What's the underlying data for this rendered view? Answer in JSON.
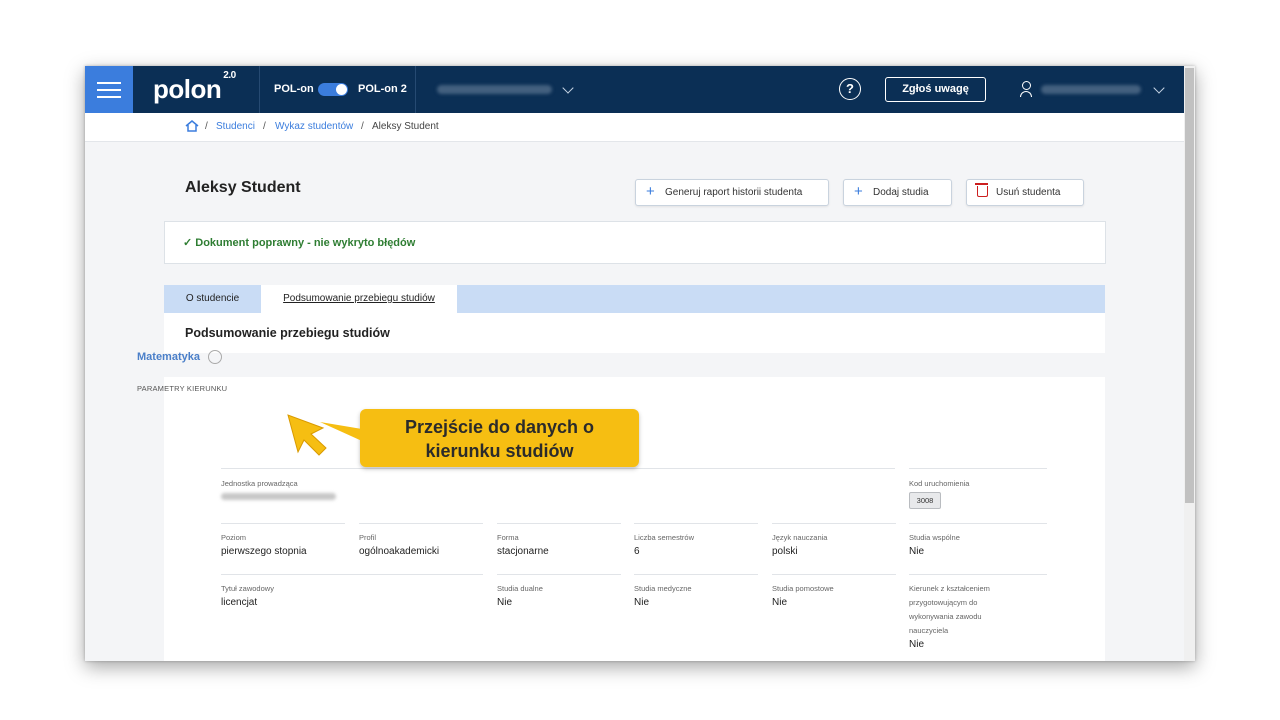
{
  "topbar": {
    "logo_text": "polon",
    "logo_sup": "2.0",
    "toggle_left": "POL-on",
    "toggle_right": "POL-on 2",
    "toggle_on": true,
    "help_icon": "help-circle-icon",
    "report_button": "Zgłoś uwagę",
    "user_icon": "user-icon",
    "accent_color": "#3b7ddd",
    "bar_color": "#0b2f55"
  },
  "breadcrumb": {
    "home_icon": "home-icon",
    "items": [
      "Studenci",
      "Wykaz studentów",
      "Aleksy Student"
    ],
    "separator": "/"
  },
  "page": {
    "title": "Aleksy Student",
    "buttons": {
      "report": "Generuj raport historii studenta",
      "add_studies": "Dodaj studia",
      "delete": "Usuń studenta"
    },
    "status_message": "✓ Dokument poprawny - nie wykryto błędów",
    "tabs": [
      "O studencie",
      "Podsumowanie przebiegu studiów"
    ],
    "active_tab": 1,
    "section_title": "Podsumowanie przebiegu studiów"
  },
  "program": {
    "link_label": "Matematyka",
    "params_header": "PARAMETRY KIERUNKU",
    "fields": {
      "unit": {
        "label": "Jednostka prowadząca",
        "value": ""
      },
      "launch_code": {
        "label": "Kod uruchomienia",
        "value": "3008"
      },
      "level": {
        "label": "Poziom",
        "value": "pierwszego stopnia"
      },
      "profile": {
        "label": "Profil",
        "value": "ogólnoakademicki"
      },
      "form": {
        "label": "Forma",
        "value": "stacjonarne"
      },
      "semesters": {
        "label": "Liczba semestrów",
        "value": "6"
      },
      "language": {
        "label": "Język nauczania",
        "value": "polski"
      },
      "joint": {
        "label": "Studia wspólne",
        "value": "Nie"
      },
      "title": {
        "label": "Tytuł zawodowy",
        "value": "licencjat"
      },
      "dual": {
        "label": "Studia dualne",
        "value": "Nie"
      },
      "medical": {
        "label": "Studia medyczne",
        "value": "Nie"
      },
      "bridging": {
        "label": "Studia pomostowe",
        "value": "Nie"
      },
      "teacher": {
        "label_lines": [
          "Kierunek z kształceniem",
          "przygotowującym do",
          "wykonywania zawodu",
          "nauczyciela"
        ],
        "value": "Nie"
      }
    }
  },
  "callout": {
    "line1": "Przejście do danych o",
    "line2": "kierunku studiów",
    "color": "#f6be12"
  }
}
